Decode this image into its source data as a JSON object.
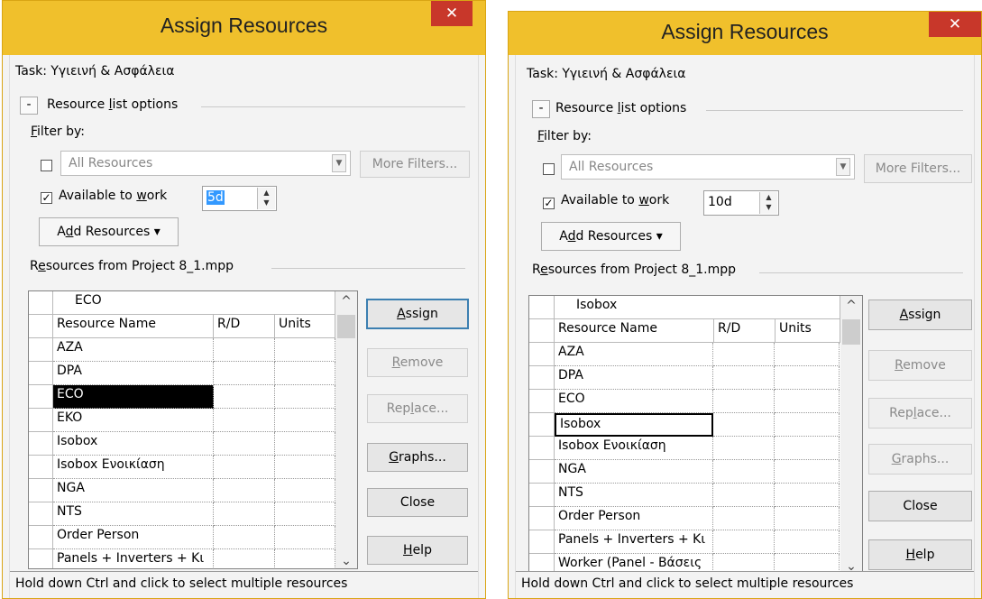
{
  "dialogs": [
    {
      "title": "Assign Resources",
      "close_glyph": "✕",
      "task_label": "Task: Υγιεινή & Ασφάλεια",
      "options_toggle": "-",
      "options_label_pre": "Resource ",
      "options_label_mn": "l",
      "options_label_post": "ist options",
      "filter_label_mn": "F",
      "filter_label_post": "ilter by:",
      "filter_value": "All Resources",
      "more_filters": "More Filters...",
      "available_pre": "Available to ",
      "available_mn": "w",
      "available_post": "ork",
      "available_checked": "✓",
      "available_value": "5d",
      "add_resources_pre": "A",
      "add_resources_mn": "d",
      "add_resources_post": "d Resources ▾",
      "resources_from_pre": "R",
      "resources_from_mn": "e",
      "resources_from_post": "sources from Project 8_1.mpp",
      "edit_value": "ECO",
      "columns": [
        "Resource Name",
        "R/D",
        "Units"
      ],
      "rows": [
        "AZA",
        "DPA",
        "ECO",
        "EKO",
        "Isobox",
        "Isobox Ενοικίαση",
        "NGA",
        "NTS",
        "Order Person",
        "Panels + Inverters + Κι"
      ],
      "buttons": {
        "assign_mn": "A",
        "assign_post": "ssign",
        "remove_mn": "R",
        "remove_post": "emove",
        "replace_pre": "Rep",
        "replace_mn": "l",
        "replace_post": "ace...",
        "graphs_mn": "G",
        "graphs_post": "raphs...",
        "close": "Close",
        "help_mn": "H",
        "help_post": "elp"
      },
      "status": "Hold down Ctrl and click to select multiple resources"
    },
    {
      "title": "Assign Resources",
      "close_glyph": "✕",
      "task_label": "Task: Υγιεινή & Ασφάλεια",
      "options_toggle": "-",
      "options_label_pre": "Resource ",
      "options_label_mn": "l",
      "options_label_post": "ist options",
      "filter_label_mn": "F",
      "filter_label_post": "ilter by:",
      "filter_value": "All Resources",
      "more_filters": "More Filters...",
      "available_pre": "Available to ",
      "available_mn": "w",
      "available_post": "ork",
      "available_checked": "✓",
      "available_value": "10d",
      "add_resources_pre": "A",
      "add_resources_mn": "d",
      "add_resources_post": "d Resources ▾",
      "resources_from_pre": "R",
      "resources_from_mn": "e",
      "resources_from_post": "sources from Project 8_1.mpp",
      "edit_value": "Isobox",
      "columns": [
        "Resource Name",
        "R/D",
        "Units"
      ],
      "rows": [
        "AZA",
        "DPA",
        "ECO",
        "Isobox",
        "Isobox Ενοικίαση",
        "NGA",
        "NTS",
        "Order Person",
        "Panels + Inverters + Κι",
        "Worker (Panel - Βάσεις"
      ],
      "buttons": {
        "assign_mn": "A",
        "assign_post": "ssign",
        "remove_mn": "R",
        "remove_post": "emove",
        "replace_pre": "Rep",
        "replace_mn": "l",
        "replace_post": "ace...",
        "graphs_mn": "G",
        "graphs_post": "raphs...",
        "close": "Close",
        "help_mn": "H",
        "help_post": "elp"
      },
      "status": "Hold down Ctrl and click to select multiple resources"
    }
  ],
  "colors": {
    "titlebar": "#f0c02c",
    "close": "#c8372a",
    "selection": "#3399ff",
    "default_button_border": "#3c7fb1"
  }
}
